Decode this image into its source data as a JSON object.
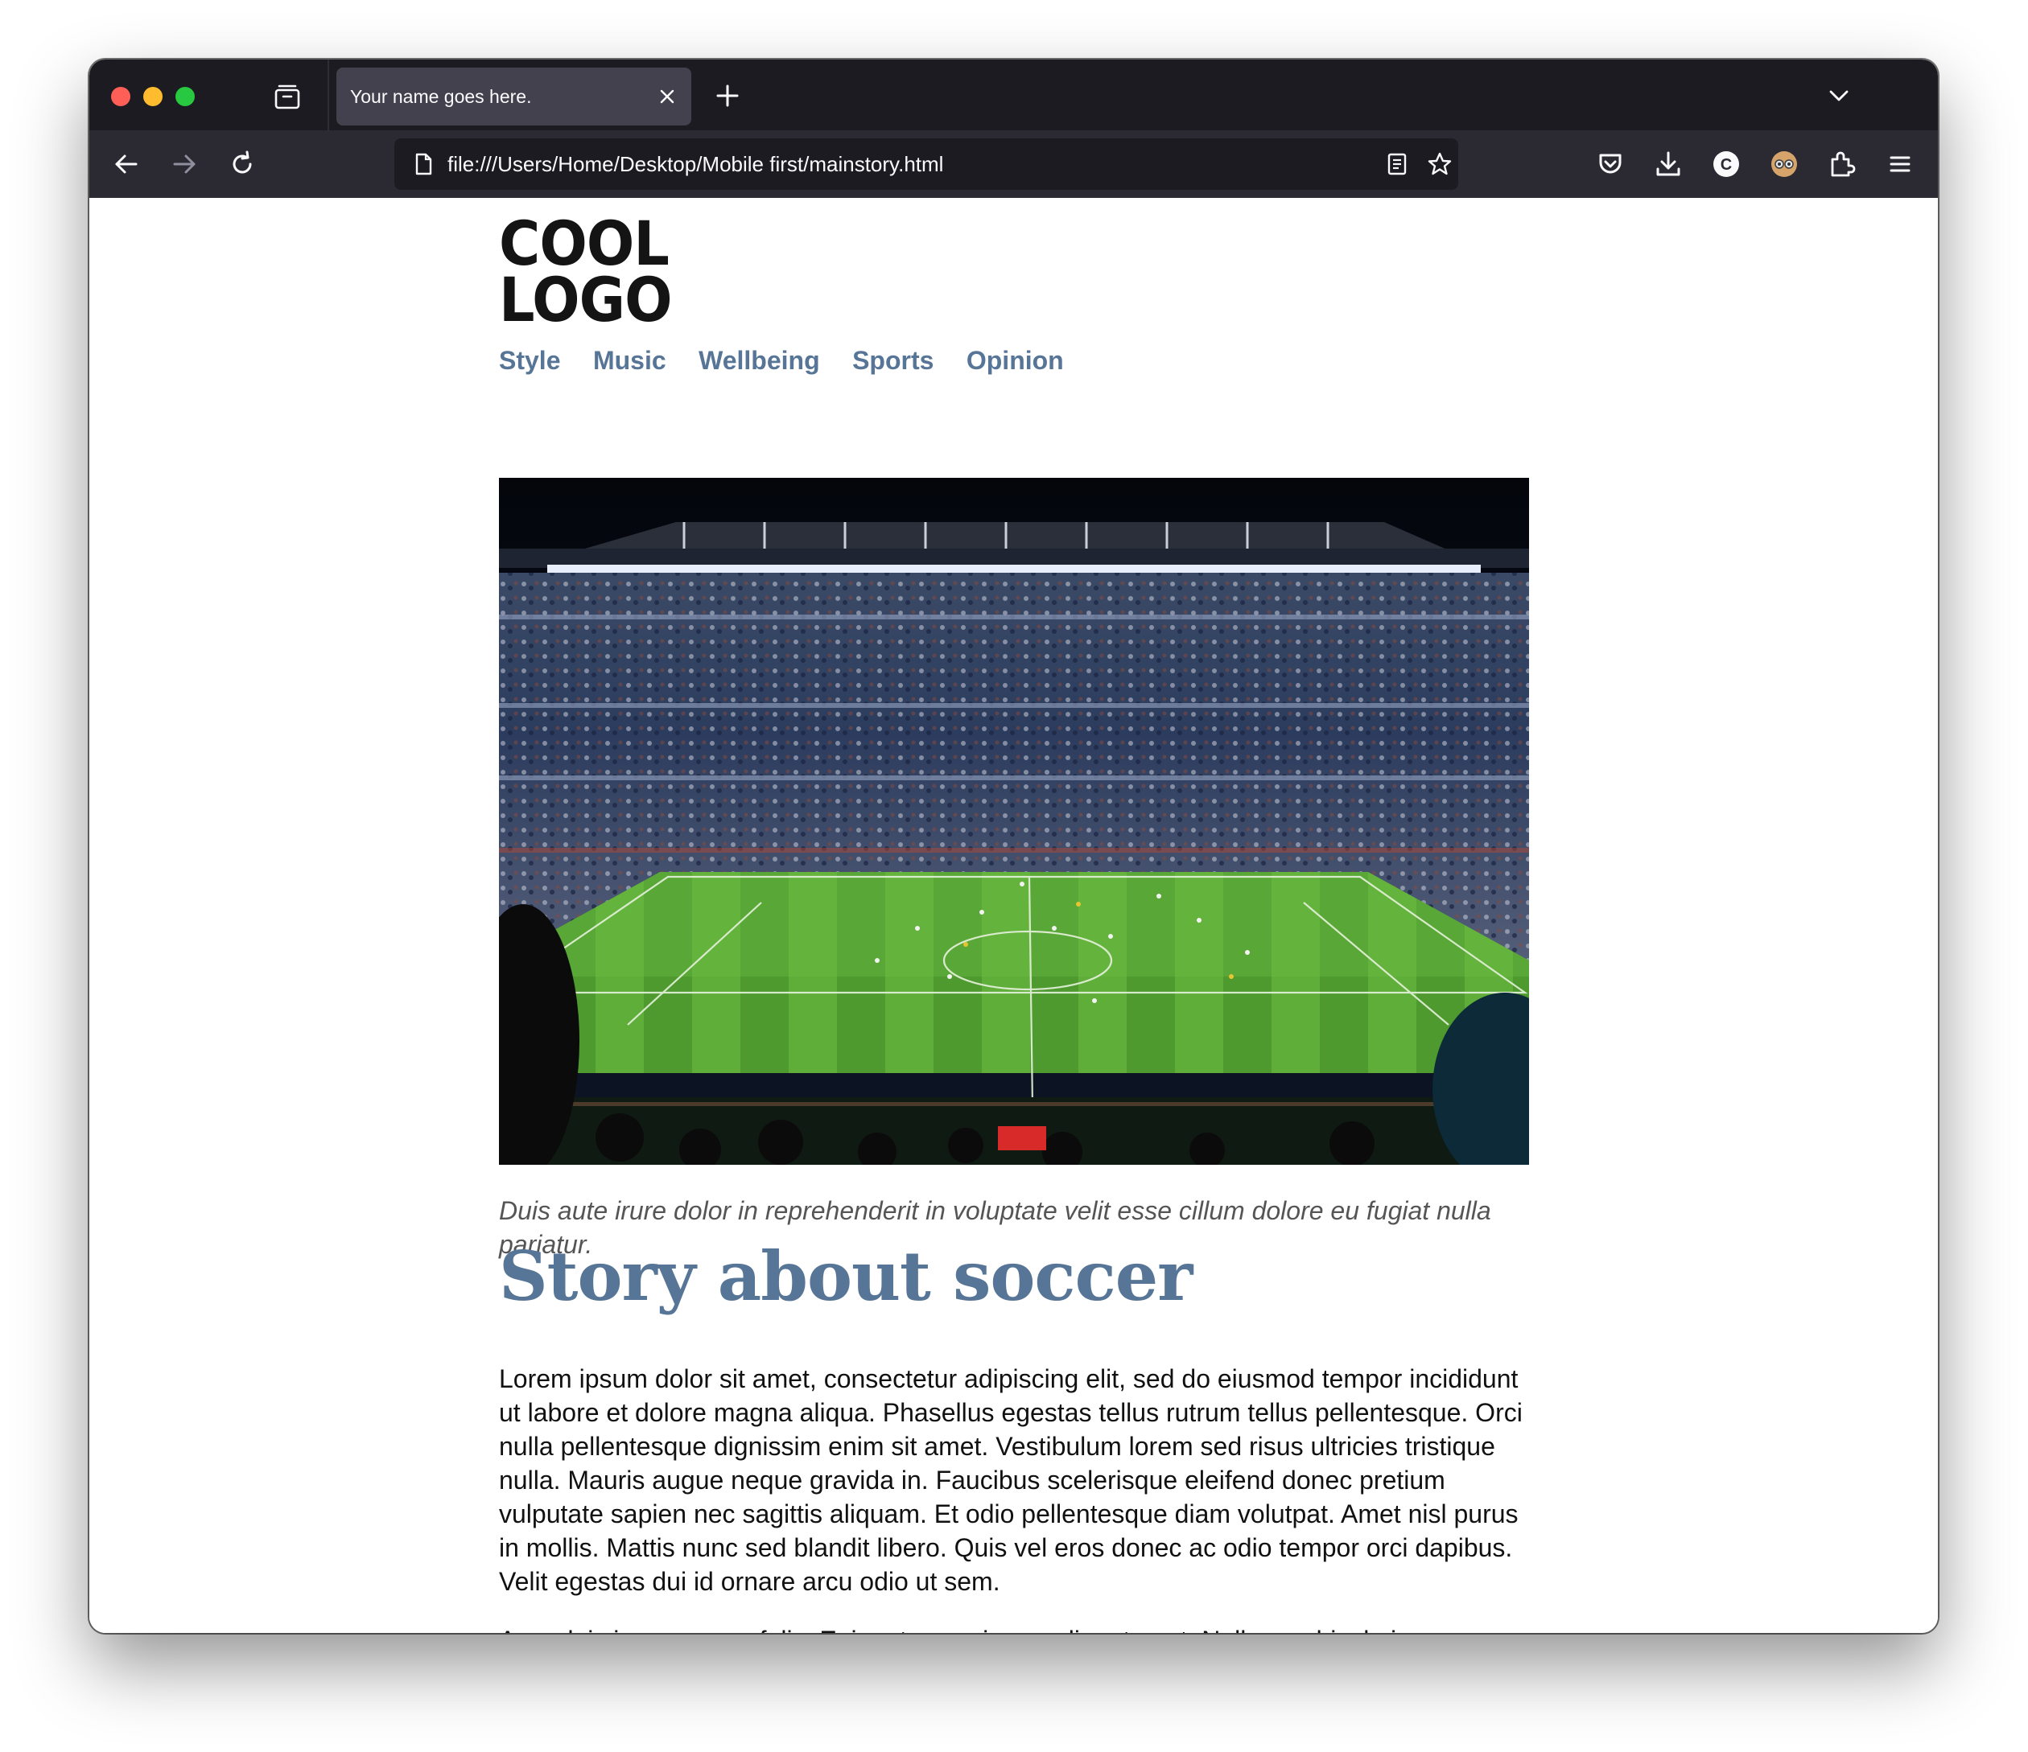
{
  "browser": {
    "tab_title": "Your name goes here.",
    "url": "file:///Users/Home/Desktop/Mobile first/mainstory.html"
  },
  "page": {
    "logo_line1": "COOL",
    "logo_line2": "LOGO",
    "nav": [
      "Style",
      "Music",
      "Wellbeing",
      "Sports",
      "Opinion"
    ],
    "image_alt": "Soccer stadium full of fans at night",
    "caption": "Duis aute irure dolor in reprehenderit in voluptate velit esse cillum dolore eu fugiat nulla pariatur.",
    "headline": "Story about soccer",
    "paragraph1": "Lorem ipsum dolor sit amet, consectetur adipiscing elit, sed do eiusmod tempor incididunt ut labore et dolore magna aliqua. Phasellus egestas tellus rutrum tellus pellentesque. Orci nulla pellentesque dignissim enim sit amet. Vestibulum lorem sed risus ultricies tristique nulla. Mauris augue neque gravida in. Faucibus scelerisque eleifend donec pretium vulputate sapien nec sagittis aliquam. Et odio pellentesque diam volutpat. Amet nisl purus in mollis. Mattis nunc sed blandit libero. Quis vel eros donec ac odio tempor orci dapibus. Velit egestas dui id ornare arcu odio ut sem.",
    "paragraph2": "Arcu dui vivamus arcu felis. Enim ut sem viverra aliquet eget. Nullam vehicula ipsum a"
  },
  "colors": {
    "accent": "#577596",
    "toolbar": "#2b2a33",
    "tabstrip": "#1c1b22"
  }
}
